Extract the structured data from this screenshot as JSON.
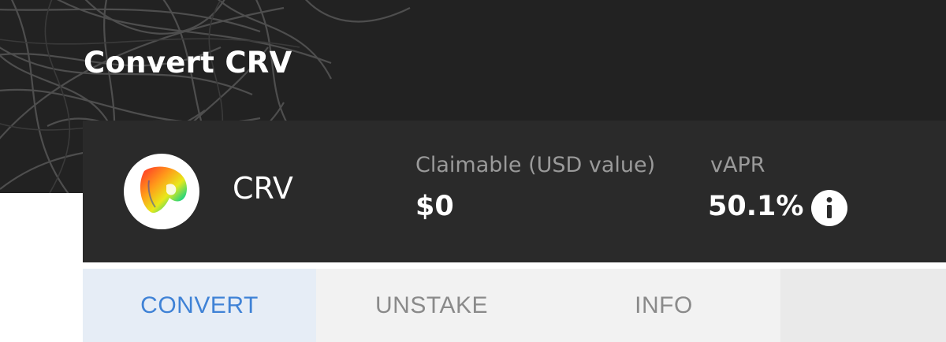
{
  "page": {
    "title": "Convert CRV"
  },
  "token": {
    "symbol": "CRV",
    "logo_icon": "curve-logo-icon"
  },
  "stats": {
    "claimable_label": "Claimable (USD value)",
    "claimable_value": "$0",
    "vapr_label": "vAPR",
    "vapr_value": "50.1%",
    "info_icon": "info-icon"
  },
  "tabs": [
    {
      "label": "CONVERT",
      "active": true
    },
    {
      "label": "UNSTAKE",
      "active": false
    },
    {
      "label": "INFO",
      "active": false
    }
  ],
  "colors": {
    "header_bg": "#222222",
    "card_bg": "#2a2a2a",
    "tab_active_bg": "#e6edf6",
    "tab_active_text": "#3f82d6",
    "tab_inactive_text": "#8a8a8a",
    "muted_text": "#9a9a9a"
  }
}
